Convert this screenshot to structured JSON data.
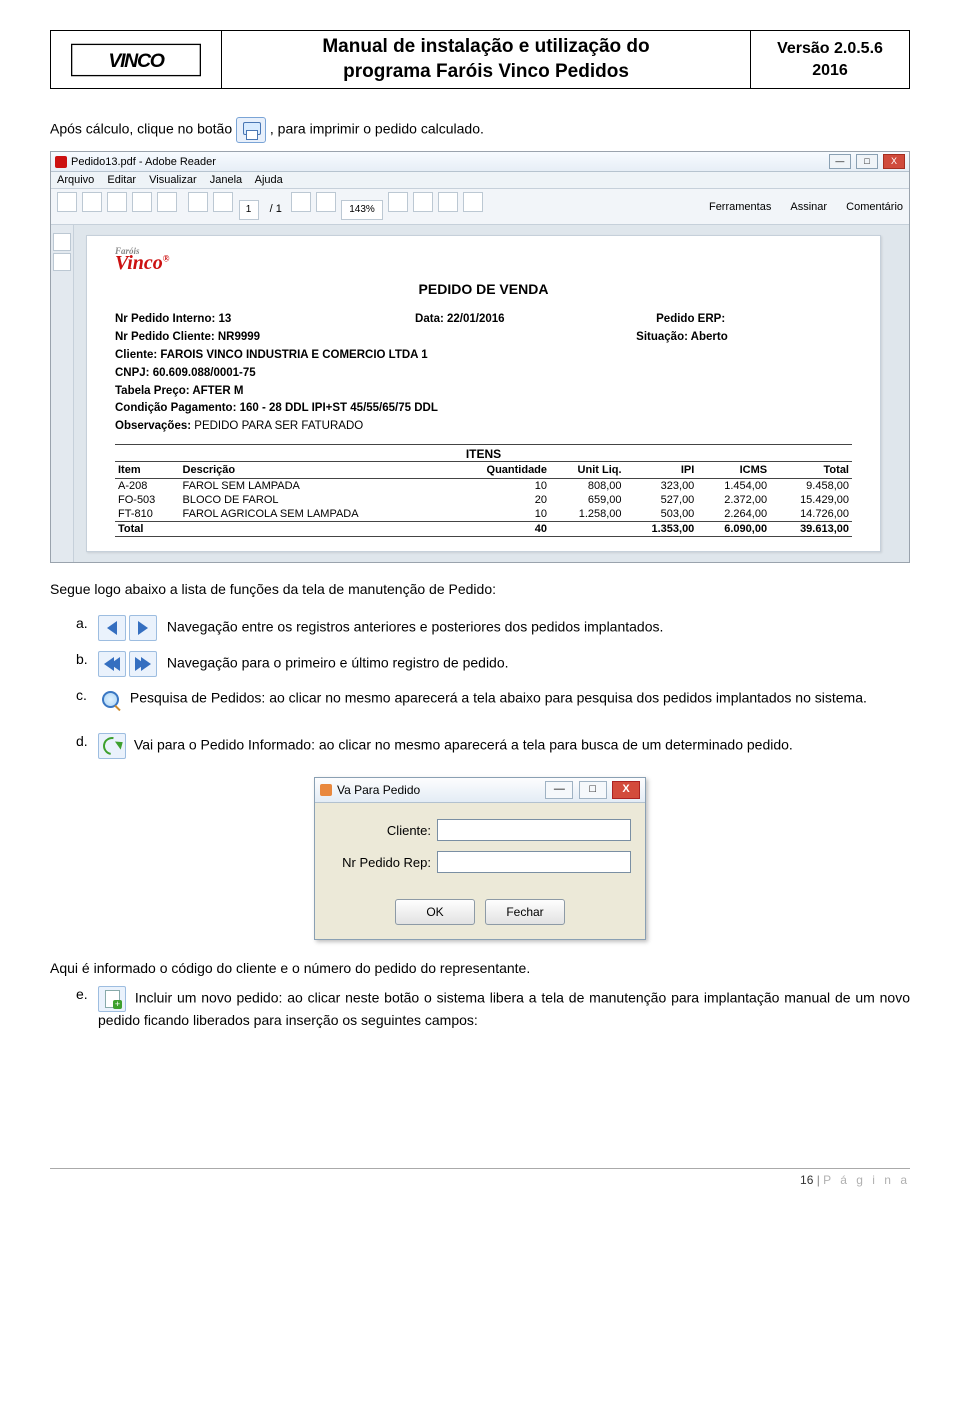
{
  "header": {
    "title_line1": "Manual de instalação e utilização do",
    "title_line2": "programa Faróis Vinco Pedidos",
    "version": "Versão 2.0.5.6",
    "year": "2016"
  },
  "intro": {
    "before": "Após cálculo, clique no botão ",
    "after": ", para imprimir o pedido calculado."
  },
  "adobe": {
    "title": "Pedido13.pdf - Adobe Reader",
    "menus": [
      "Arquivo",
      "Editar",
      "Visualizar",
      "Janela",
      "Ajuda"
    ],
    "pg_cur": "1",
    "pg_total": "/ 1",
    "zoom": "143%",
    "right_tabs": [
      "Ferramentas",
      "Assinar",
      "Comentário"
    ],
    "logo_sub": "Faróis",
    "logo_text": "Vinco",
    "doc_title": "PEDIDO DE VENDA",
    "f_pedido_int": "Nr Pedido Interno: 13",
    "f_data": "Data: 22/01/2016",
    "f_pedido_erp": "Pedido ERP:",
    "f_pedido_cli": "Nr Pedido Cliente: NR9999",
    "f_situacao": "Situação: Aberto",
    "f_cliente": "Cliente: FAROIS VINCO INDUSTRIA E COMERCIO LTDA       1",
    "f_cnpj": "CNPJ: 60.609.088/0001-75",
    "f_tabela": "Tabela Preço: AFTER M",
    "f_cond": "Condição Pagamento: 160 - 28 DDL IPI+ST  45/55/65/75 DDL",
    "f_obs": "Observações: PEDIDO PARA SER FATURADO",
    "itens_label": "ITENS",
    "cols": {
      "item": "Item",
      "desc": "Descrição",
      "qt": "Quantidade",
      "unit": "Unit Liq.",
      "ipi": "IPI",
      "icms": "ICMS",
      "total": "Total"
    },
    "rows": [
      {
        "item": "A-208",
        "desc": "FAROL SEM LAMPADA",
        "qt": "10",
        "unit": "808,00",
        "ipi": "323,00",
        "icms": "1.454,00",
        "total": "9.458,00"
      },
      {
        "item": "FO-503",
        "desc": "BLOCO DE FAROL",
        "qt": "20",
        "unit": "659,00",
        "ipi": "527,00",
        "icms": "2.372,00",
        "total": "15.429,00"
      },
      {
        "item": "FT-810",
        "desc": "FAROL AGRICOLA SEM LAMPADA",
        "qt": "10",
        "unit": "1.258,00",
        "ipi": "503,00",
        "icms": "2.264,00",
        "total": "14.726,00"
      }
    ],
    "total_row": {
      "label": "Total",
      "qt": "40",
      "ipi": "1.353,00",
      "icms": "6.090,00",
      "total": "39.613,00"
    }
  },
  "list_heading": "Segue logo abaixo a lista de funções da tela de manutenção de Pedido:",
  "items": {
    "a": "Navegação entre os registros anteriores e posteriores dos pedidos implantados.",
    "b": "Navegação para o primeiro e último registro de pedido.",
    "c": "Pesquisa de Pedidos: ao clicar no mesmo aparecerá a tela abaixo para pesquisa dos pedidos implantados no sistema.",
    "d": "Vai para o Pedido Informado: ao clicar no mesmo aparecerá a tela para busca de um determinado pedido.",
    "e": "Incluir um novo pedido: ao clicar neste botão o sistema libera a tela de manutenção para implantação manual de um novo pedido ficando liberados para inserção os seguintes campos:"
  },
  "dialog": {
    "title": "Va Para Pedido",
    "lbl_cliente": "Cliente:",
    "lbl_nr": "Nr Pedido Rep:",
    "btn_ok": "OK",
    "btn_close": "Fechar",
    "min": "—",
    "max": "□",
    "x": "X"
  },
  "after_dialog": "Aqui é informado o código do cliente e o número do pedido do representante.",
  "footer": {
    "num": "16",
    "label": "P á g i n a"
  }
}
